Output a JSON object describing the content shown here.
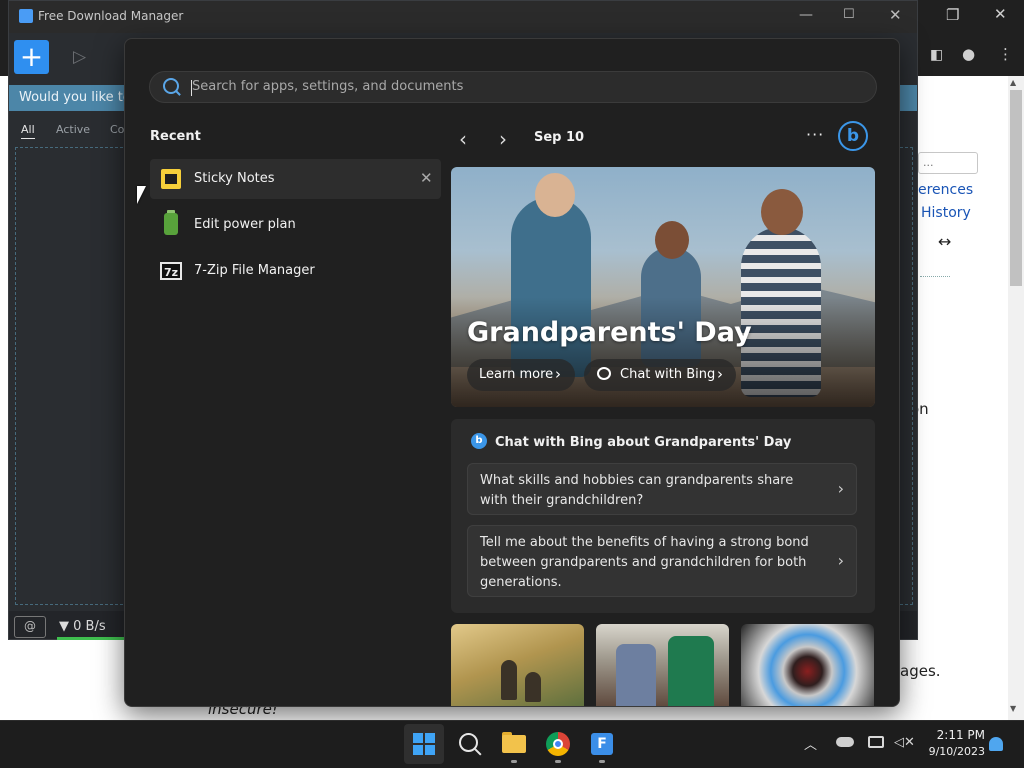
{
  "fdm": {
    "title": "Free Download Manager",
    "add_label": "+",
    "banner": "Would you like to",
    "tabs": [
      "All",
      "Active",
      "Cor"
    ],
    "speed": "0 B/s"
  },
  "browser": {
    "text_1": "erences",
    "text_2": "History",
    "arrow": "↔",
    "text_3": "on",
    "text_4": "ages.",
    "text_5": "insecure!",
    "input_value": "..."
  },
  "start_menu": {
    "search_placeholder": "Search for apps, settings, and documents",
    "recent_heading": "Recent",
    "recent": [
      {
        "label": "Sticky Notes",
        "icon": "sticky-notes-icon"
      },
      {
        "label": "Edit power plan",
        "icon": "battery-icon"
      },
      {
        "label": "7-Zip File Manager",
        "icon": "7zip-icon"
      }
    ],
    "zip_glyph": "7z",
    "date": "Sep 10",
    "more_glyph": "···",
    "bing_glyph": "b",
    "hero": {
      "title": "Grandparents' Day",
      "learn_more": "Learn more",
      "chat_with_bing": "Chat with Bing"
    },
    "chat_card": {
      "title": "Chat with Bing about Grandparents' Day",
      "suggestions": [
        "What skills and hobbies can grandparents share with their grandchildren?",
        "Tell me about the benefits of having a strong bond between grandparents and grandchildren for both generations."
      ]
    }
  },
  "taskbar": {
    "time": "2:11 PM",
    "date": "9/10/2023",
    "fdm_glyph": "F"
  },
  "colors": {
    "accent": "#3b96e8",
    "fdm_blue": "#2f8ff0",
    "sticky_yellow": "#f6cf3a"
  }
}
